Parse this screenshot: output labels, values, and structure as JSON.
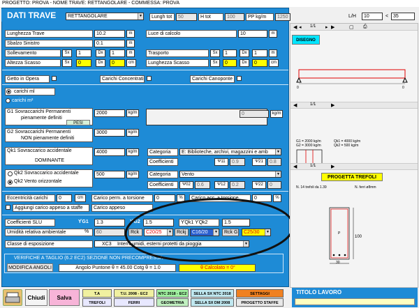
{
  "window": {
    "title": "PROGETTO: PROVA - NOME TRAVE: RETTANGOLARE - COMMESSA: PROVA"
  },
  "header": {
    "title": "DATI TRAVE",
    "section_type": "RETTANGOLARE",
    "lungh_tot_label": "Lungh tot",
    "lungh_tot": "50",
    "h_tot_label": "H tot",
    "h_tot": "100",
    "pp_label": "PP kg/m",
    "pp": "1250",
    "lh_label": "L/H",
    "lh": "10",
    "lh_cmp": "<",
    "lh_max": "35"
  },
  "geom": {
    "lunghezza_trave_label": "Lunghezza Trave",
    "lunghezza_trave": "10.2",
    "lunghezza_trave_unit": "m",
    "luce_calcolo_label": "Luce di calcolo",
    "luce_calcolo": "10",
    "luce_calcolo_unit": "m",
    "sbalzo_label": "Sbalzo Sinistro",
    "sbalzo": "0.1",
    "sbalzo_unit": "m",
    "sollevamento_label": "Sollevamento",
    "soll_sx_label": "Sx",
    "soll_sx": "1",
    "soll_dx_label": "Dx",
    "soll_dx": "1",
    "soll_unit": "m",
    "trasporto_label": "Trasporto",
    "tras_sx_label": "Sx",
    "tras_sx": "1",
    "tras_dx_label": "Dx",
    "tras_dx": "1",
    "tras_unit": "m",
    "altezza_label": "Altezza Scasso",
    "alt_sx_label": "Sx",
    "alt_sx": "0",
    "alt_dx_label": "Dx",
    "alt_dx": "0",
    "alt_unit": "cm",
    "lunghezza_scasso_label": "Lunghezza Scasso",
    "lsc_sx_label": "Sx",
    "lsc_sx": "0",
    "lsc_dx_label": "Dx",
    "lsc_dx": "0",
    "lsc_unit": "cm"
  },
  "checks": {
    "getto": "Getto in Opera",
    "concentrati": "Carichi Concentrati",
    "campo": "Carichi Canoponte"
  },
  "loads": {
    "carichi_ml": "carichi ml",
    "carichi_m2": "carichi m²",
    "g1_title": "G1   Sovraccarichi Permanenti",
    "g1_sub": "pienamente definiti",
    "g1_val": "2000",
    "g1_unit": "kg/m",
    "pesi_label": "PESI",
    "g1_extra": "0",
    "g1_extra_unit": "kg/m",
    "g2_title": "G2   Sovraccarichi Permanenti",
    "g2_sub": "NON pienamente definiti",
    "g2_val": "3000",
    "g2_unit": "kg/m",
    "qk1_title": "Qk1  Sovraccarico accidentale",
    "qk1_sub": "DOMINANTE",
    "qk1_val": "4000",
    "qk1_unit": "kg/m",
    "categoria_label": "Categoria",
    "categoria1": "E: Biblioteche, archivi, magazzini e amb",
    "coefficienti_label": "Coefficienti",
    "psi1_label": "Ψ11",
    "psi1": "0.9",
    "psi2_label": "Ψ21",
    "psi2": "0.8",
    "qk2a_label": "Qk2  Sovraccarico accidentale",
    "qk2b_label": "Qk2  Vento orizzontale",
    "qk2_val": "500",
    "qk2_unit": "kg/m",
    "categoria2": "Vento",
    "psi02_label": "Ψ02",
    "psi02": "0.6",
    "psi12_label": "Ψ12",
    "psi12": "0.2",
    "psi22_label": "Ψ22",
    "psi22": "0"
  },
  "eccentric": {
    "ecc_label": "Eccentricità carichi",
    "ecc_val": "0",
    "ecc_unit": "cm",
    "perm_label": "Carico perm. a torsione",
    "perm_val": "0",
    "perm_unit": "%",
    "acc_label": "Carico acc. a torsione",
    "acc_val": "0",
    "acc_unit": "%",
    "aggiungi_label": "Aggiungi carico appeso a staffe",
    "appeso_label": "Carico appeso"
  },
  "materials": {
    "coeff_slu_label": "Coefficienti SLU",
    "yg1_label": "ϒG1",
    "yg1": "1.3",
    "yg2_label": "ϒG2",
    "yg2": "1.5",
    "yqk_label": "ϒQk1 ϒQk2",
    "yqk": "1.5",
    "umidita_label": "Umidità relativa ambientale",
    "umidita_unit": "%",
    "umidita": "60",
    "rck_label": "Rck",
    "rck1": "C20/25",
    "rckj_label": "Rckj",
    "rckj": "C16/20",
    "rckg_label": "Rck G",
    "rckg": "C25/30",
    "classe_label": "Classe di esposizione",
    "classe_code": "XC3",
    "classe_desc": "Interni umidi, esterni protetti da pioggia"
  },
  "verifiche": {
    "title": "VERIFICHE A TAGLIO (6.2 EC2) SEZIONE NON PRECOMPRESSA",
    "modifica": "MODIFICA ANGOLI",
    "angolo": "Angolo Puntone  θ = 45.00     Cotg θ = 1.0",
    "calcolato": "θ  Calcolato = 0°"
  },
  "bottom": {
    "chiudi": "Chiudi",
    "salva": "Salva",
    "b1": "T.A",
    "b2": "T.U. 2008 - EC2",
    "b3": "NTC 2018 - EC2",
    "b4": "SELLA SX NTC 2018",
    "b5": "SETTAGGI",
    "b6": "TREFOLI",
    "b7": "FERRI",
    "b8": "GEOMETRIA",
    "b9": "SELLA SX DM 2008",
    "b10": "PROGETTO STAFFE",
    "titolo_lavoro": "TITOLO LAVORO"
  },
  "drawing": {
    "nav1": "1/1",
    "disegno": "DISEGNO",
    "nav2": "1/1",
    "g1_line": "G1 = 2000 kg/m",
    "g2_line": "G2 = 3000 kg/m",
    "qk1_line": "Qk1 = 4000 kg/m",
    "qk2_line": "Qk2 = 500 kg/m",
    "nav3": "1/1",
    "trefoli_title": "PROGETTA TREFOLI",
    "trefoli_n": "N. 14 trefoli da 1.39",
    "ferri_n": "N. ferri  ø8mm",
    "dim_h": "100",
    "dim_b": "30",
    "label_p": "P",
    "left0": "0",
    "right0": "0"
  },
  "colors": {
    "panel": "#1e8bd6",
    "yellow": "#ffff00",
    "red": "#e00000"
  }
}
